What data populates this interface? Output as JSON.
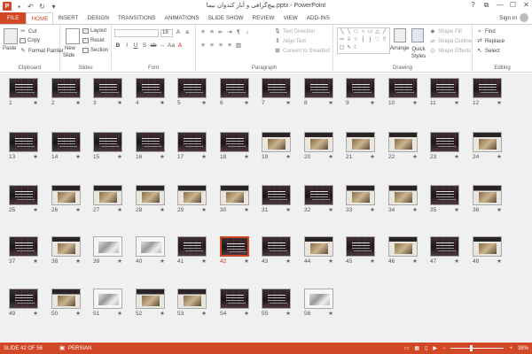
{
  "window": {
    "title": "پیچ‌گرافی و آنار کندوان نیما.pptx - PowerPoint",
    "signin": "Sign in",
    "controls": [
      "?",
      "⧉",
      "—",
      "☐",
      "✕"
    ]
  },
  "qat": [
    "save-icon",
    "undo-icon",
    "redo-icon",
    "customize-icon"
  ],
  "tabs": [
    "FILE",
    "HOME",
    "INSERT",
    "DESIGN",
    "TRANSITIONS",
    "ANIMATIONS",
    "SLIDE SHOW",
    "REVIEW",
    "VIEW",
    "ADD-INS"
  ],
  "active_tab": "HOME",
  "ribbon": {
    "clipboard": {
      "paste": "Paste",
      "cut": "Cut",
      "copy": "Copy",
      "format_painter": "Format Painter",
      "label": "Clipboard"
    },
    "slides": {
      "new_slide": "New",
      "new_slide2": "Slide",
      "layout": "Layout",
      "reset": "Reset",
      "section": "Section",
      "label": "Slides"
    },
    "font": {
      "label": "Font",
      "size_value": "18"
    },
    "paragraph": {
      "text_direction": "Text Direction",
      "align_text": "Align Text",
      "convert": "Convert to SmartArt",
      "label": "Paragraph"
    },
    "drawing": {
      "arrange": "Arrange",
      "quick_styles": "Quick Styles",
      "shape_fill": "Shape Fill",
      "shape_outline": "Shape Outline",
      "shape_effects": "Shape Effects",
      "label": "Drawing"
    },
    "editing": {
      "find": "Find",
      "replace": "Replace",
      "select": "Select",
      "label": "Editing"
    }
  },
  "slides": [
    {
      "n": "1",
      "style": "dark"
    },
    {
      "n": "2",
      "style": "dark"
    },
    {
      "n": "3",
      "style": "dark"
    },
    {
      "n": "4",
      "style": "dark"
    },
    {
      "n": "5",
      "style": "dark"
    },
    {
      "n": "6",
      "style": "dark"
    },
    {
      "n": "7",
      "style": "dark"
    },
    {
      "n": "8",
      "style": "dark"
    },
    {
      "n": "9",
      "style": "dark"
    },
    {
      "n": "10",
      "style": "dark"
    },
    {
      "n": "11",
      "style": "dark"
    },
    {
      "n": "12",
      "style": "dark"
    },
    {
      "n": "13",
      "style": "dark"
    },
    {
      "n": "14",
      "style": "dark"
    },
    {
      "n": "15",
      "style": "dark"
    },
    {
      "n": "16",
      "style": "dark"
    },
    {
      "n": "17",
      "style": "dark"
    },
    {
      "n": "18",
      "style": "dark"
    },
    {
      "n": "19",
      "style": "photo"
    },
    {
      "n": "20",
      "style": "photo"
    },
    {
      "n": "21",
      "style": "photo"
    },
    {
      "n": "22",
      "style": "photo"
    },
    {
      "n": "23",
      "style": "dark"
    },
    {
      "n": "24",
      "style": "photo"
    },
    {
      "n": "25",
      "style": "dark"
    },
    {
      "n": "26",
      "style": "photo"
    },
    {
      "n": "27",
      "style": "photo"
    },
    {
      "n": "28",
      "style": "photo"
    },
    {
      "n": "29",
      "style": "photo"
    },
    {
      "n": "30",
      "style": "photo"
    },
    {
      "n": "31",
      "style": "dark"
    },
    {
      "n": "32",
      "style": "dark"
    },
    {
      "n": "33",
      "style": "photo"
    },
    {
      "n": "34",
      "style": "photo"
    },
    {
      "n": "35",
      "style": "dark"
    },
    {
      "n": "36",
      "style": "photo"
    },
    {
      "n": "37",
      "style": "dark"
    },
    {
      "n": "38",
      "style": "photo"
    },
    {
      "n": "39",
      "style": "light"
    },
    {
      "n": "40",
      "style": "light"
    },
    {
      "n": "41",
      "style": "dark"
    },
    {
      "n": "42",
      "style": "dark"
    },
    {
      "n": "43",
      "style": "dark"
    },
    {
      "n": "44",
      "style": "photo"
    },
    {
      "n": "45",
      "style": "dark"
    },
    {
      "n": "46",
      "style": "photo"
    },
    {
      "n": "47",
      "style": "dark"
    },
    {
      "n": "48",
      "style": "photo"
    },
    {
      "n": "49",
      "style": "dark"
    },
    {
      "n": "50",
      "style": "photo"
    },
    {
      "n": "51",
      "style": "light"
    },
    {
      "n": "52",
      "style": "photo"
    },
    {
      "n": "53",
      "style": "photo"
    },
    {
      "n": "54",
      "style": "dark"
    },
    {
      "n": "55",
      "style": "dark"
    },
    {
      "n": "56",
      "style": "light"
    }
  ],
  "selected_slide": "42",
  "status": {
    "slide_info": "SLIDE 42 OF 56",
    "language": "PERSIAN",
    "zoom": "38%",
    "zoom_fraction": 0.38
  },
  "colors": {
    "accent": "#d24726"
  }
}
